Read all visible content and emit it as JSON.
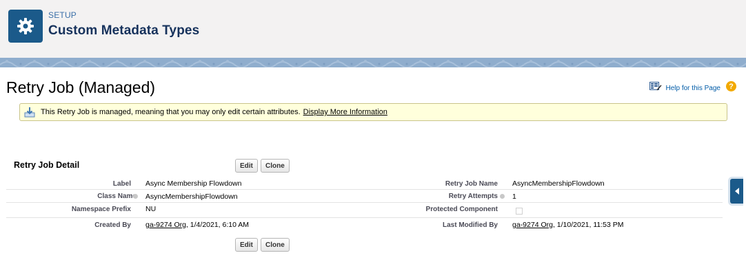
{
  "header": {
    "section": "SETUP",
    "title": "Custom Metadata Types"
  },
  "page": {
    "title": "Retry Job (Managed)",
    "help_link": "Help for this Page"
  },
  "banner": {
    "text": "This Retry Job is managed, meaning that you may only edit certain attributes.",
    "link": "Display More Information"
  },
  "detail": {
    "title": "Retry Job Detail",
    "edit_label": "Edit",
    "clone_label": "Clone",
    "fields": {
      "label": {
        "label": "Label",
        "value": "Async Membership Flowdown"
      },
      "retry_job_name": {
        "label": "Retry Job Name",
        "value": "AsyncMembershipFlowdown"
      },
      "class_name": {
        "label": "Class Name",
        "value": "AsyncMembershipFlowdown"
      },
      "retry_attempts": {
        "label": "Retry Attempts",
        "value": "1"
      },
      "namespace_prefix": {
        "label": "Namespace Prefix",
        "value": "NU"
      },
      "protected_component": {
        "label": "Protected Component",
        "value": ""
      },
      "created_by": {
        "label": "Created By",
        "user": "ga-9274 Org",
        "date": ", 1/4/2021, 6:10 AM"
      },
      "last_modified_by": {
        "label": "Last Modified By",
        "user": "ga-9274 Org",
        "date": ", 1/10/2021, 11:53 PM"
      }
    }
  },
  "colors": {
    "header_bg": "#f3f2f2",
    "icon_bg": "#1b5a8a",
    "banner_bg": "#ffffdc",
    "link_blue": "#015ba7"
  },
  "icons": {
    "setup": "gear-icon",
    "help_page": "help-grid-icon",
    "help": "question-mark-icon",
    "banner": "download-tray-icon",
    "side_tab": "caret-left-icon"
  }
}
